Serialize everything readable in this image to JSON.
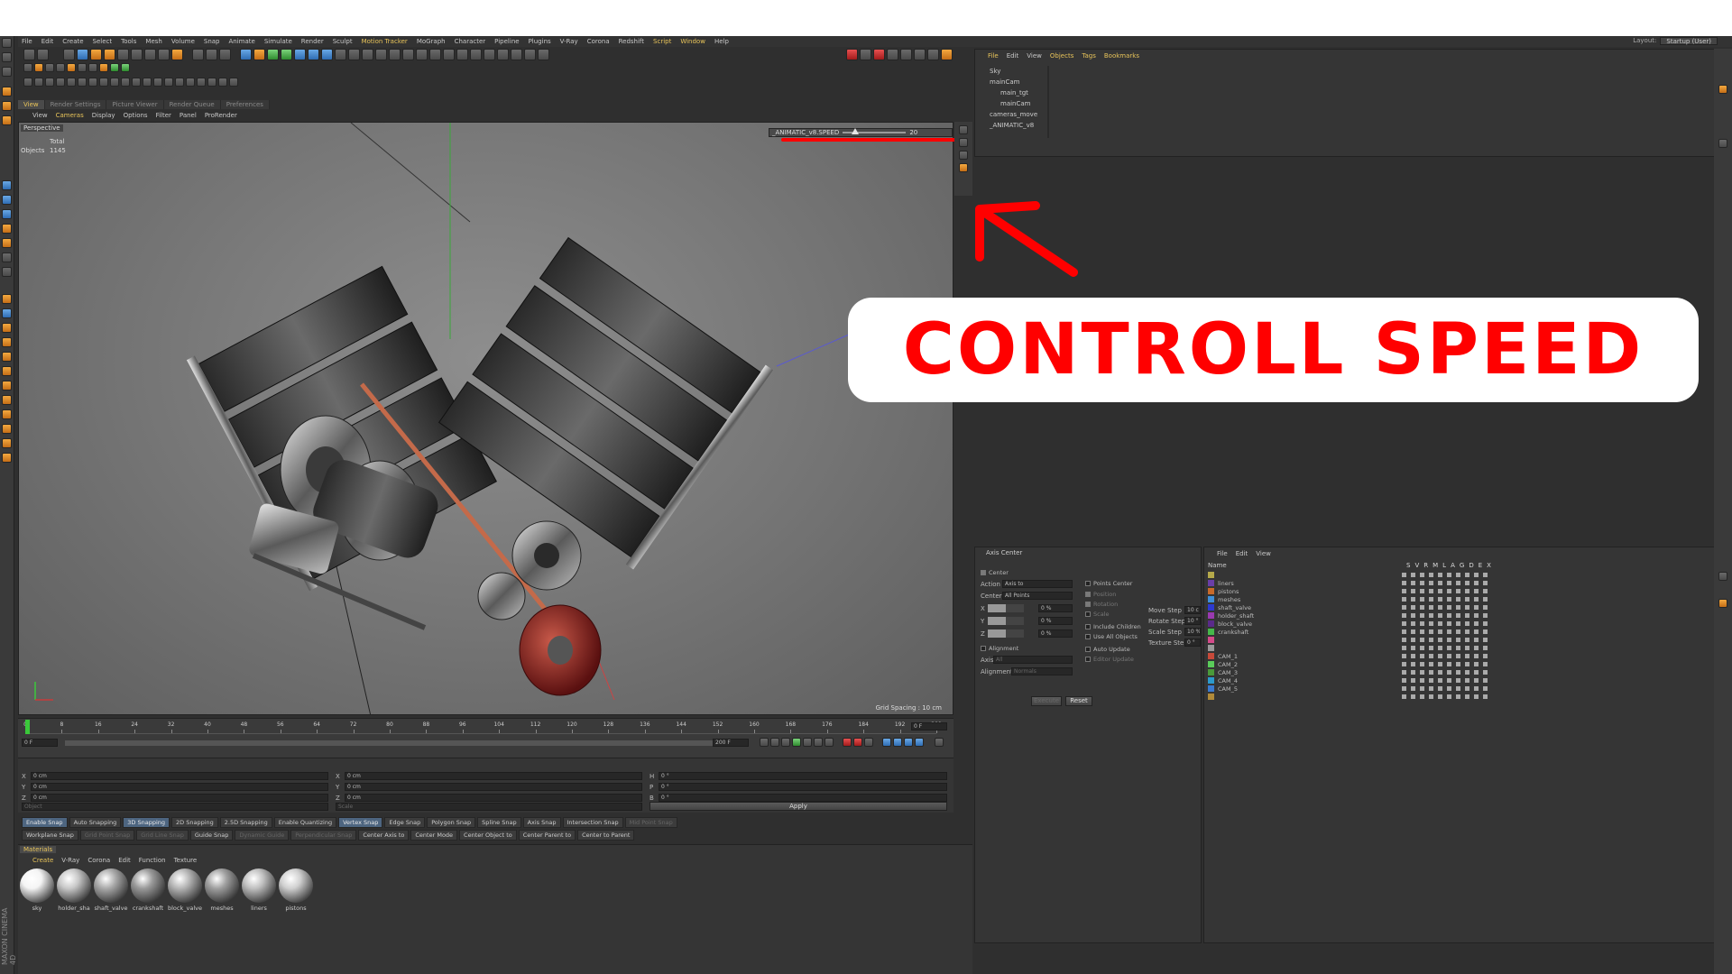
{
  "menu": [
    "File",
    "Edit",
    "Create",
    "Select",
    "Tools",
    "Mesh",
    "Volume",
    "Snap",
    "Animate",
    "Simulate",
    "Render",
    "Sculpt",
    "Motion Tracker",
    "MoGraph",
    "Character",
    "Pipeline",
    "Plugins",
    "V-Ray",
    "Corona",
    "Redshift",
    "Script",
    "Window",
    "Help"
  ],
  "layout": {
    "label": "Layout:",
    "value": "Startup (User)"
  },
  "viewport_tabs": [
    "View",
    "Render Settings",
    "Picture Viewer",
    "Render Queue",
    "Preferences"
  ],
  "viewport_menu": [
    "View",
    "Cameras",
    "Display",
    "Options",
    "Filter",
    "Panel",
    "ProRender"
  ],
  "viewport": {
    "mode": "Perspective",
    "stats_header": "Total",
    "stats_label": "Objects",
    "stats_value": "1145",
    "grid_spacing": "Grid Spacing : 10 cm"
  },
  "speed_slider": {
    "label": "_ANIMATIC_v8.SPEED",
    "value": "20",
    "level": 0.2
  },
  "object_manager": {
    "menu": [
      "File",
      "Edit",
      "View",
      "Objects",
      "Tags",
      "Bookmarks"
    ],
    "objects": [
      {
        "name": "Sky",
        "indent": 0
      },
      {
        "name": "mainCam",
        "indent": 0
      },
      {
        "name": "main_tgt",
        "indent": 1
      },
      {
        "name": "mainCam",
        "indent": 1
      },
      {
        "name": "cameras_move",
        "indent": 0
      },
      {
        "name": "_ANIMATIC_v8",
        "indent": 0
      }
    ]
  },
  "annotation": {
    "text": "CONTROLL SPEED",
    "color": "#ff0000"
  },
  "timeline": {
    "ticks": [
      "0",
      "8",
      "16",
      "24",
      "32",
      "40",
      "48",
      "56",
      "64",
      "72",
      "80",
      "88",
      "96",
      "104",
      "112",
      "120",
      "128",
      "136",
      "144",
      "152",
      "160",
      "168",
      "176",
      "184",
      "192",
      "200"
    ],
    "current_frame": "0 F",
    "start_frame": "0 F",
    "end_frame": "200 F",
    "preview_end": "200 F",
    "end_field": "0 F"
  },
  "coords": {
    "labels": [
      "X",
      "Y",
      "Z"
    ],
    "pos": [
      "0 cm",
      "0 cm",
      "0 cm"
    ],
    "size": [
      "0 cm",
      "0 cm",
      "0 cm"
    ],
    "rot_labels": [
      "H",
      "P",
      "B"
    ],
    "rot": [
      "0 °",
      "0 °",
      "0 °"
    ],
    "mode1": "Object",
    "mode2": "Scale",
    "apply": "Apply"
  },
  "snap_row1": [
    {
      "label": "Enable Snap",
      "on": true
    },
    {
      "label": "Auto Snapping",
      "on": false
    },
    {
      "label": "3D Snapping",
      "on": true
    },
    {
      "label": "2D Snapping",
      "on": false
    },
    {
      "label": "2.5D Snapping",
      "on": false
    },
    {
      "label": "Enable Quantizing",
      "on": false
    },
    {
      "label": "Vertex Snap",
      "on": true
    },
    {
      "label": "Edge Snap",
      "on": false
    },
    {
      "label": "Polygon Snap",
      "on": false
    },
    {
      "label": "Spline Snap",
      "on": false
    },
    {
      "label": "Axis Snap",
      "on": false
    },
    {
      "label": "Intersection Snap",
      "on": false
    },
    {
      "label": "Mid Point Snap",
      "on": false,
      "dim": true
    }
  ],
  "snap_row2": [
    {
      "label": "Workplane Snap",
      "on": false
    },
    {
      "label": "Grid Point Snap",
      "on": false,
      "dim": true
    },
    {
      "label": "Grid Line Snap",
      "on": false,
      "dim": true
    },
    {
      "label": "Guide Snap",
      "on": false
    },
    {
      "label": "Dynamic Guide",
      "on": false,
      "dim": true
    },
    {
      "label": "Perpendicular Snap",
      "on": false,
      "dim": true
    },
    {
      "label": "Center Axis to",
      "on": false
    },
    {
      "label": "Center Mode",
      "on": false
    },
    {
      "label": "Center Object to",
      "on": false
    },
    {
      "label": "Center Parent to",
      "on": false
    },
    {
      "label": "Center to Parent",
      "on": false
    }
  ],
  "materials": {
    "tab": "Materials",
    "menu": [
      "Create",
      "V-Ray",
      "Corona",
      "Edit",
      "Function",
      "Texture"
    ],
    "items": [
      "sky",
      "holder_sha",
      "shaft_valve",
      "crankshaft",
      "block_valve",
      "meshes",
      "liners",
      "pistons"
    ]
  },
  "axis_center": {
    "title": "Axis Center",
    "center_label": "Center",
    "action_label": "Action",
    "action_value": "Axis to",
    "center_field_label": "Center",
    "center_value": "All Points",
    "axes": [
      "X",
      "Y",
      "Z"
    ],
    "percents": [
      "0 %",
      "0 %",
      "0 %"
    ],
    "alignment_label": "Alignment",
    "axis_label": "Axis",
    "axis_value": "All",
    "alignment_field_label": "Alignment",
    "alignment_value": "Normals",
    "options": [
      "Points Center",
      "Position",
      "Rotation",
      "Scale",
      "Include Children",
      "Use All Objects",
      "Auto Update",
      "Editor Update"
    ],
    "steps": [
      {
        "label": "Move Step",
        "value": "10 c"
      },
      {
        "label": "Rotate Step",
        "value": "10 °"
      },
      {
        "label": "Scale Step",
        "value": "10 %"
      },
      {
        "label": "Texture Step",
        "value": "0 °"
      }
    ],
    "execute": "Execute",
    "reset": "Reset"
  },
  "layers": {
    "menu": [
      "File",
      "Edit",
      "View"
    ],
    "name_header": "Name",
    "col_headers": [
      "S",
      "V",
      "R",
      "M",
      "L",
      "A",
      "G",
      "D",
      "E",
      "X"
    ],
    "rows": [
      {
        "name": "",
        "color": "#b5a94a"
      },
      {
        "name": "liners",
        "color": "#6a3ea8"
      },
      {
        "name": "pistons",
        "color": "#c86a2a"
      },
      {
        "name": "meshes",
        "color": "#3f8fd8"
      },
      {
        "name": "shaft_valve",
        "color": "#2c3ad0"
      },
      {
        "name": "holder_shaft",
        "color": "#9a3ab0"
      },
      {
        "name": "block_valve",
        "color": "#5a2a8a"
      },
      {
        "name": "crankshaft",
        "color": "#46b84a"
      },
      {
        "name": "",
        "color": "#d44a8a"
      },
      {
        "name": "",
        "color": "#9a9a9a"
      },
      {
        "name": "CAM_1",
        "color": "#c84a3a"
      },
      {
        "name": "CAM_2",
        "color": "#5acc5a"
      },
      {
        "name": "CAM_3",
        "color": "#4a9a3a"
      },
      {
        "name": "CAM_4",
        "color": "#2c9acc"
      },
      {
        "name": "CAM_5",
        "color": "#3a7ad0"
      },
      {
        "name": "",
        "color": "#b08a3a"
      }
    ]
  },
  "brand": "MAXON CINEMA 4D",
  "colors": {
    "accent": "#e8c45a",
    "annotation": "#ff0000",
    "viewport_bg": "#7a7a7a"
  }
}
